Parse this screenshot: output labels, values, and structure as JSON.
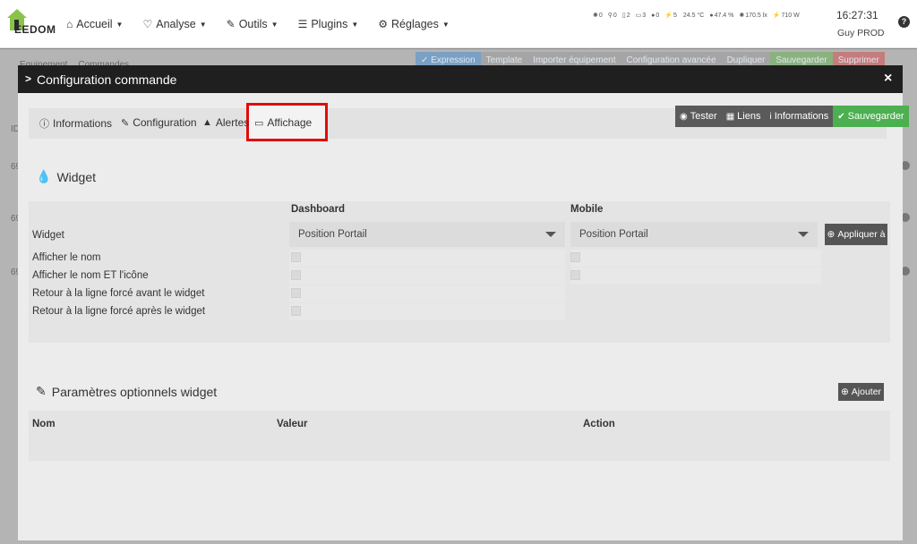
{
  "brand": {
    "logo_text": "EEDOM"
  },
  "navbar": {
    "items": [
      {
        "icon": "home-icon",
        "glyph": "⌂",
        "label": "Accueil"
      },
      {
        "icon": "stethoscope-icon",
        "glyph": "♡",
        "label": "Analyse"
      },
      {
        "icon": "wrench-icon",
        "glyph": "✎",
        "label": "Outils"
      },
      {
        "icon": "list-icon",
        "glyph": "☰",
        "label": "Plugins"
      },
      {
        "icon": "gear-icon",
        "glyph": "⚙",
        "label": "Réglages"
      }
    ],
    "sensors": [
      {
        "glyph": "✺",
        "value": "0"
      },
      {
        "glyph": "⚲",
        "value": "0"
      },
      {
        "glyph": "▯",
        "value": "2"
      },
      {
        "glyph": "▭",
        "value": "3"
      },
      {
        "glyph": "●",
        "value": "0"
      },
      {
        "glyph": "⚡",
        "value": "5"
      },
      {
        "glyph": "",
        "value": "24.5 °C"
      },
      {
        "glyph": "●",
        "value": "47.4 %"
      },
      {
        "glyph": "✺",
        "value": "170.5 lx"
      },
      {
        "glyph": "⚡",
        "value": "710 W"
      }
    ],
    "time": "16:27:31",
    "user": "Guy PROD",
    "help": "?"
  },
  "background": {
    "tabs": [
      "Equipement",
      "Commandes"
    ],
    "toolbar": [
      {
        "label": "✓ Expression",
        "color": "blue"
      },
      {
        "label": "Template",
        "color": "grey"
      },
      {
        "label": "Importer équipement",
        "color": "grey"
      },
      {
        "label": "Configuration avancée",
        "color": "grey"
      },
      {
        "label": "Dupliquer",
        "color": "grey"
      },
      {
        "label": "Sauvegarder",
        "color": "green"
      },
      {
        "label": "Supprimer",
        "color": "red"
      }
    ],
    "side_labels": [
      "ID",
      "69",
      "69",
      "69"
    ]
  },
  "modal": {
    "title": "Configuration commande",
    "close": "×",
    "tabs": [
      {
        "icon": "info-icon",
        "glyph": "ⓘ",
        "label": "Informations"
      },
      {
        "icon": "wrench-icon",
        "glyph": "✎",
        "label": "Configuration"
      },
      {
        "icon": "warning-icon",
        "glyph": "▲",
        "label": "Alertes"
      },
      {
        "icon": "monitor-icon",
        "glyph": "▭",
        "label": "Affichage"
      }
    ],
    "actions": [
      {
        "glyph": "◉",
        "label": "Tester"
      },
      {
        "glyph": "▦",
        "label": "Liens"
      },
      {
        "glyph": "i",
        "label": "Informations"
      },
      {
        "glyph": "✔",
        "label": "Sauvegarder",
        "color": "green"
      }
    ],
    "widget_section": {
      "title": "Widget",
      "col_dashboard": "Dashboard",
      "col_mobile": "Mobile",
      "widget_label": "Widget",
      "dashboard_value": "Position Portail",
      "mobile_value": "Position Portail",
      "apply_label": "Appliquer à",
      "rows": [
        "Afficher le nom",
        "Afficher le nom ET l'icône",
        "Retour à la ligne forcé avant le widget",
        "Retour à la ligne forcé après le widget"
      ]
    },
    "params_section": {
      "title": "Paramètres optionnels widget",
      "add_label": "Ajouter",
      "columns": [
        "Nom",
        "Valeur",
        "Action"
      ]
    }
  },
  "colors": {
    "green": "#4caf50",
    "highlight": "#e20a0a",
    "header": "#1f1f1f"
  }
}
